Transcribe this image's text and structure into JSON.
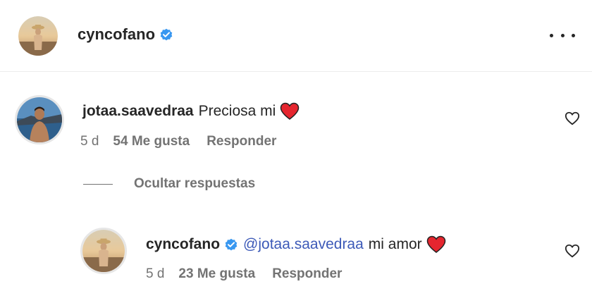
{
  "post_author": {
    "username": "cyncofano",
    "verified": true
  },
  "comment": {
    "username": "jotaa.saavedraa",
    "text": "Preciosa mi",
    "emoji": "red-heart",
    "time": "5 d",
    "likes": "54 Me gusta",
    "reply_label": "Responder"
  },
  "hide_replies_label": "Ocultar respuestas",
  "reply": {
    "username": "cyncofano",
    "verified": true,
    "mention": "@jotaa.saavedraa",
    "text": "mi amor",
    "emoji": "red-heart",
    "time": "5 d",
    "likes": "23 Me gusta",
    "reply_label": "Responder"
  },
  "colors": {
    "verified_badge": "#3897f0",
    "mention": "#3d5ab8",
    "secondary_text": "#737373",
    "heart_emoji": "#e5262f"
  },
  "icons": {
    "more": "more-horizontal-icon",
    "like": "heart-outline-icon",
    "verified": "verified-badge-icon"
  }
}
